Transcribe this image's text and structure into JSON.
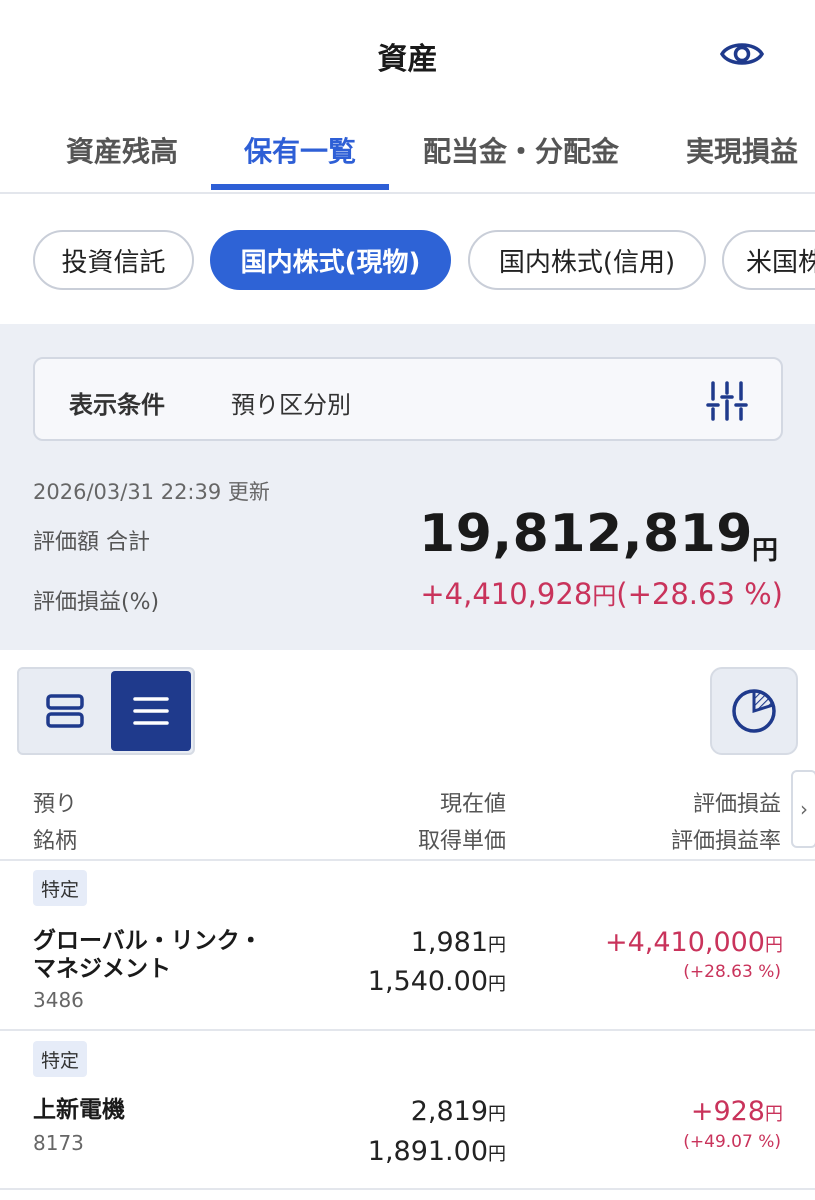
{
  "header": {
    "title": "資産",
    "eye_icon": "eye-icon"
  },
  "tabs": [
    {
      "label": "資産残高",
      "active": false
    },
    {
      "label": "保有一覧",
      "active": true
    },
    {
      "label": "配当金・分配金",
      "active": false
    },
    {
      "label": "実現損益",
      "active": false
    }
  ],
  "chips": [
    {
      "label": "投資信託",
      "active": false
    },
    {
      "label": "国内株式(現物)",
      "active": true
    },
    {
      "label": "国内株式(信用)",
      "active": false
    },
    {
      "label": "米国株",
      "active": false
    }
  ],
  "filter": {
    "label": "表示条件",
    "value": "預り区分別",
    "icon": "sliders-icon"
  },
  "summary": {
    "updated": "2026/03/31 22:39 更新",
    "total_label": "評価額 合計",
    "total_value": "19,812,819",
    "total_unit": "円",
    "pl_label": "評価損益(%)",
    "pl_value": "+4,410,928",
    "pl_unit": "円",
    "pl_pct": "(+28.63 %)"
  },
  "toolbar": {
    "card_view_icon": "card-view-icon",
    "list_view_icon": "list-view-icon",
    "pie_icon": "pie-chart-icon"
  },
  "columns": {
    "c1_line1": "預り",
    "c1_line2": "銘柄",
    "c2_line1": "現在値",
    "c2_line2": "取得単価",
    "c3_line1": "評価損益",
    "c3_line2": "評価損益率",
    "arrow": "›"
  },
  "holdings": [
    {
      "badge": "特定",
      "name_line1": "グローバル・リンク・",
      "name_line2": "マネジメント",
      "code": "3486",
      "price": "1,981",
      "price_unit": "円",
      "cost": "1,540.00",
      "cost_unit": "円",
      "pl": "+4,410,000",
      "pl_unit": "円",
      "pl_pct": "(+28.63 %)"
    },
    {
      "badge": "特定",
      "name_line1": "上新電機",
      "name_line2": "",
      "code": "8173",
      "price": "2,819",
      "price_unit": "円",
      "cost": "1,891.00",
      "cost_unit": "円",
      "pl": "+928",
      "pl_unit": "円",
      "pl_pct": "(+49.07 %)"
    }
  ],
  "colors": {
    "accent": "#2e5fd6",
    "gain": "#c9335b",
    "list_active": "#1f3a8c"
  }
}
